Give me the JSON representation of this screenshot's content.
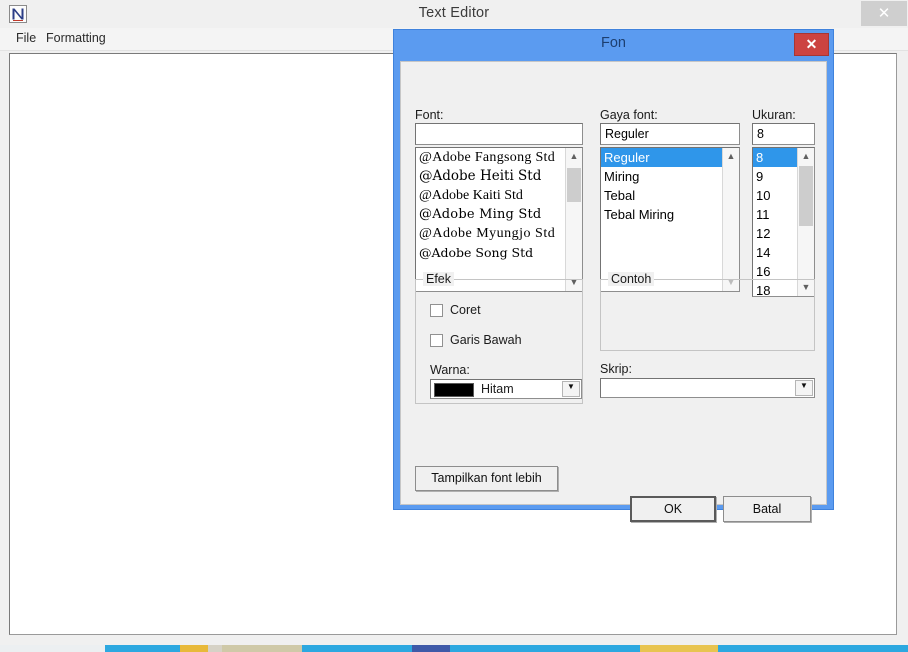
{
  "editor": {
    "title": "Text Editor",
    "app_icon": "notepad-n-icon",
    "close_label": "✕",
    "menu": [
      {
        "label": "File"
      },
      {
        "label": "Formatting"
      }
    ],
    "textarea_value": ""
  },
  "dialog": {
    "title": "Fon",
    "close_label": "✕",
    "close_color": "#cc4341",
    "titlebar_color": "#5b9bf0",
    "font": {
      "label": "Font:",
      "input_value": "",
      "items": [
        "@Adobe Fangsong Std",
        "@Adobe Heiti Std",
        "@Adobe Kaiti Std",
        "@Adobe Ming Std",
        "@Adobe Myungjo Std",
        "@Adobe Song Std"
      ],
      "selected_index": -1
    },
    "style": {
      "label": "Gaya font:",
      "input_value": "Reguler",
      "items": [
        "Reguler",
        "Miring",
        "Tebal",
        "Tebal Miring"
      ],
      "selected_index": 0
    },
    "size": {
      "label": "Ukuran:",
      "input_value": "8",
      "items": [
        "8",
        "9",
        "10",
        "11",
        "12",
        "14",
        "16",
        "18"
      ],
      "selected_index": 0
    },
    "effects": {
      "caption": "Efek",
      "strikeout": {
        "label": "Coret",
        "checked": false
      },
      "underline": {
        "label": "Garis Bawah",
        "checked": false
      },
      "color": {
        "label": "Warna:",
        "value": "Hitam",
        "swatch_hex": "#000000"
      }
    },
    "sample": {
      "caption": "Contoh",
      "text": ""
    },
    "script": {
      "label": "Skrip:",
      "value": ""
    },
    "buttons": {
      "show_more_fonts": "Tampilkan font lebih",
      "ok": "OK",
      "cancel": "Batal"
    },
    "selection_color": "#2f96ea"
  }
}
